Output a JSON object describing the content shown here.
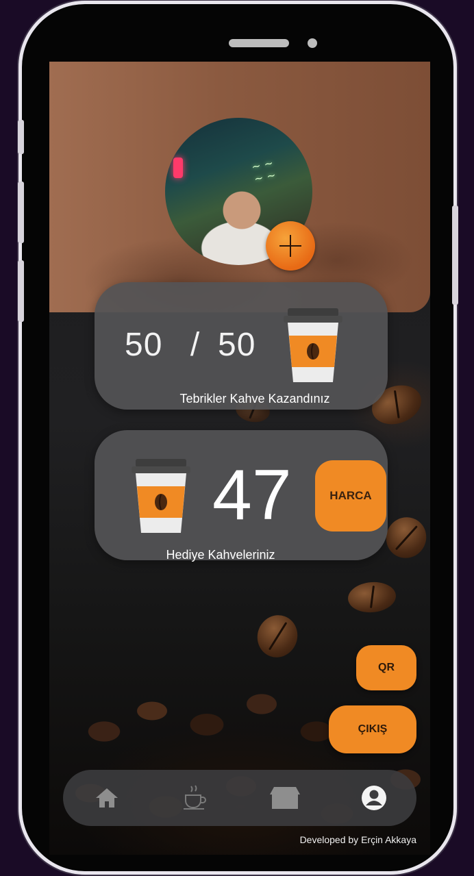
{
  "stamp_card": {
    "current": "50",
    "separator": "/",
    "target": "50",
    "message": "Tebrikler Kahve Kazandınız"
  },
  "gift_card": {
    "count": "47",
    "label": "Hediye Kahveleriniz",
    "spend_label": "HARCA"
  },
  "actions": {
    "qr_label": "QR",
    "exit_label": "ÇIKIŞ"
  },
  "nav": {
    "items": [
      "home-icon",
      "coffee-icon",
      "store-icon",
      "profile-icon"
    ],
    "active": "profile-icon"
  },
  "footer": {
    "credit": "Developed by Erçin Akkaya"
  },
  "colors": {
    "accent": "#f08a24",
    "card": "#545456",
    "header": "#8b5a40",
    "cup_sleeve": "#f08a24"
  }
}
